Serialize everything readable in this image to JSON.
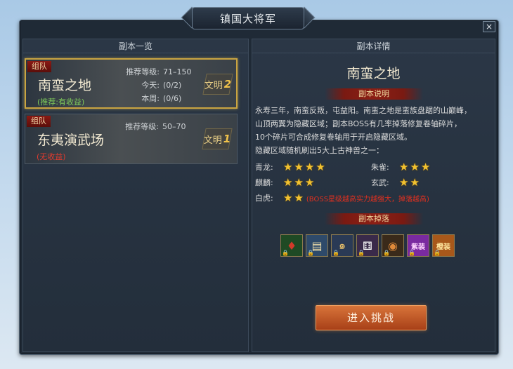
{
  "window": {
    "title": "镇国大将军",
    "close": "×"
  },
  "left_panel": {
    "header": "副本一览",
    "dungeons": [
      {
        "tag": "组队",
        "name": "南蛮之地",
        "note": "(推荐:有收益)",
        "stats": [
          {
            "label": "推荐等级:",
            "value": "71–150"
          },
          {
            "label": "今天:",
            "value": "(0/2)"
          },
          {
            "label": "本周:",
            "value": "(0/6)"
          }
        ],
        "rank_label": "文明",
        "rank_num": "2"
      },
      {
        "tag": "组队",
        "name": "东夷演武场",
        "note": "(无收益)",
        "stats": [
          {
            "label": "推荐等级:",
            "value": "50–70"
          }
        ],
        "rank_label": "文明",
        "rank_num": "1"
      }
    ]
  },
  "right_panel": {
    "header": "副本详情",
    "title": "南蛮之地",
    "desc_ribbon": "副本说明",
    "desc_lines": [
      "永寿三年，南蛮反叛，屯益阳。南蛮之地是蛮族盘踞的山巅峰，",
      "山顶两翼为隐藏区域；副本BOSS有几率掉落修复卷轴碎片，",
      "10个碎片可合成修复卷轴用于开启隐藏区域。",
      "隐藏区域随机刷出5大上古神兽之一："
    ],
    "beasts": [
      {
        "name": "青龙:",
        "stars": 4
      },
      {
        "name": "朱雀:",
        "stars": 3
      },
      {
        "name": "麒麟:",
        "stars": 3
      },
      {
        "name": "玄武:",
        "stars": 2
      },
      {
        "name": "白虎:",
        "stars": 2
      }
    ],
    "beast_note": "(BOSS星级越高实力越强大，掉落越高)",
    "drops_ribbon": "副本掉落",
    "drops": [
      {
        "icon": "red-gem-icon",
        "glyph": "♦",
        "color": "#d23a2a",
        "bg": "#1f4a24"
      },
      {
        "icon": "scroll-map-icon",
        "glyph": "▤",
        "color": "#e8d9a8",
        "bg": "#2e4a6a"
      },
      {
        "icon": "ear-scroll-icon",
        "glyph": "๑",
        "color": "#e8c06a",
        "bg": "#2a3a55"
      },
      {
        "icon": "dice-icon",
        "glyph": "⚅",
        "color": "#ffffff",
        "bg": "#3a2a4a"
      },
      {
        "icon": "armor-icon",
        "glyph": "◉",
        "color": "#e08a3a",
        "bg": "#3a2a1a"
      },
      {
        "icon": "purple-equip-icon",
        "glyph": "紫装",
        "color": "#ffd6ff",
        "bg": "#7a2aa0"
      },
      {
        "icon": "orange-equip-icon",
        "glyph": "橙装",
        "color": "#ffe8a0",
        "bg": "#a8581a"
      }
    ],
    "enter_button": "进入挑战"
  }
}
